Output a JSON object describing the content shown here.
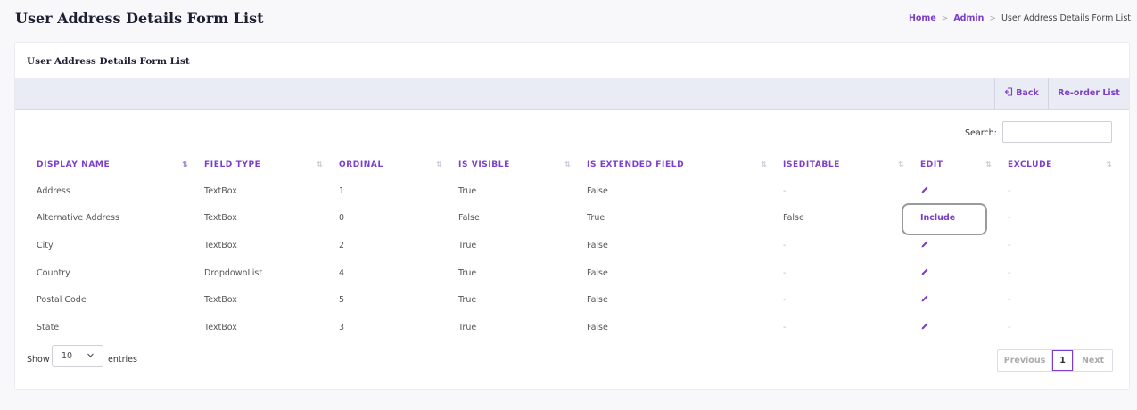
{
  "page": {
    "title": "User Address Details Form List"
  },
  "breadcrumb": {
    "items": [
      "Home",
      "Admin",
      "User Address Details Form List"
    ],
    "separator": ">"
  },
  "card": {
    "title": "User Address Details Form List"
  },
  "toolbar": {
    "back_label": "Back",
    "reorder_label": "Re-order List"
  },
  "search": {
    "label": "Search:",
    "value": ""
  },
  "table": {
    "columns": [
      "DISPLAY NAME",
      "FIELD TYPE",
      "ORDINAL",
      "IS VISIBLE",
      "IS EXTENDED FIELD",
      "ISEDITABLE",
      "EDIT",
      "EXCLUDE"
    ],
    "rows": [
      {
        "display_name": "Address",
        "field_type": "TextBox",
        "ordinal": "1",
        "is_visible": "True",
        "is_extended": "False",
        "iseditable": "-",
        "edit": "pencil",
        "exclude": "-"
      },
      {
        "display_name": "Alternative Address",
        "field_type": "TextBox",
        "ordinal": "0",
        "is_visible": "False",
        "is_extended": "True",
        "iseditable": "False",
        "edit": "Include",
        "exclude": "-"
      },
      {
        "display_name": "City",
        "field_type": "TextBox",
        "ordinal": "2",
        "is_visible": "True",
        "is_extended": "False",
        "iseditable": "-",
        "edit": "pencil",
        "exclude": "-"
      },
      {
        "display_name": "Country",
        "field_type": "DropdownList",
        "ordinal": "4",
        "is_visible": "True",
        "is_extended": "False",
        "iseditable": "-",
        "edit": "pencil",
        "exclude": "-"
      },
      {
        "display_name": "Postal Code",
        "field_type": "TextBox",
        "ordinal": "5",
        "is_visible": "True",
        "is_extended": "False",
        "iseditable": "-",
        "edit": "pencil",
        "exclude": "-"
      },
      {
        "display_name": "State",
        "field_type": "TextBox",
        "ordinal": "3",
        "is_visible": "True",
        "is_extended": "False",
        "iseditable": "-",
        "edit": "pencil",
        "exclude": "-"
      }
    ]
  },
  "length_menu": {
    "show_label": "Show",
    "value": "10",
    "entries_label": "entries"
  },
  "pagination": {
    "previous": "Previous",
    "current_page": "1",
    "next": "Next"
  },
  "colors": {
    "accent": "#7b3fc9",
    "toolbar_bg": "#e9ebf5",
    "highlight_border": "#9a9a9a"
  }
}
